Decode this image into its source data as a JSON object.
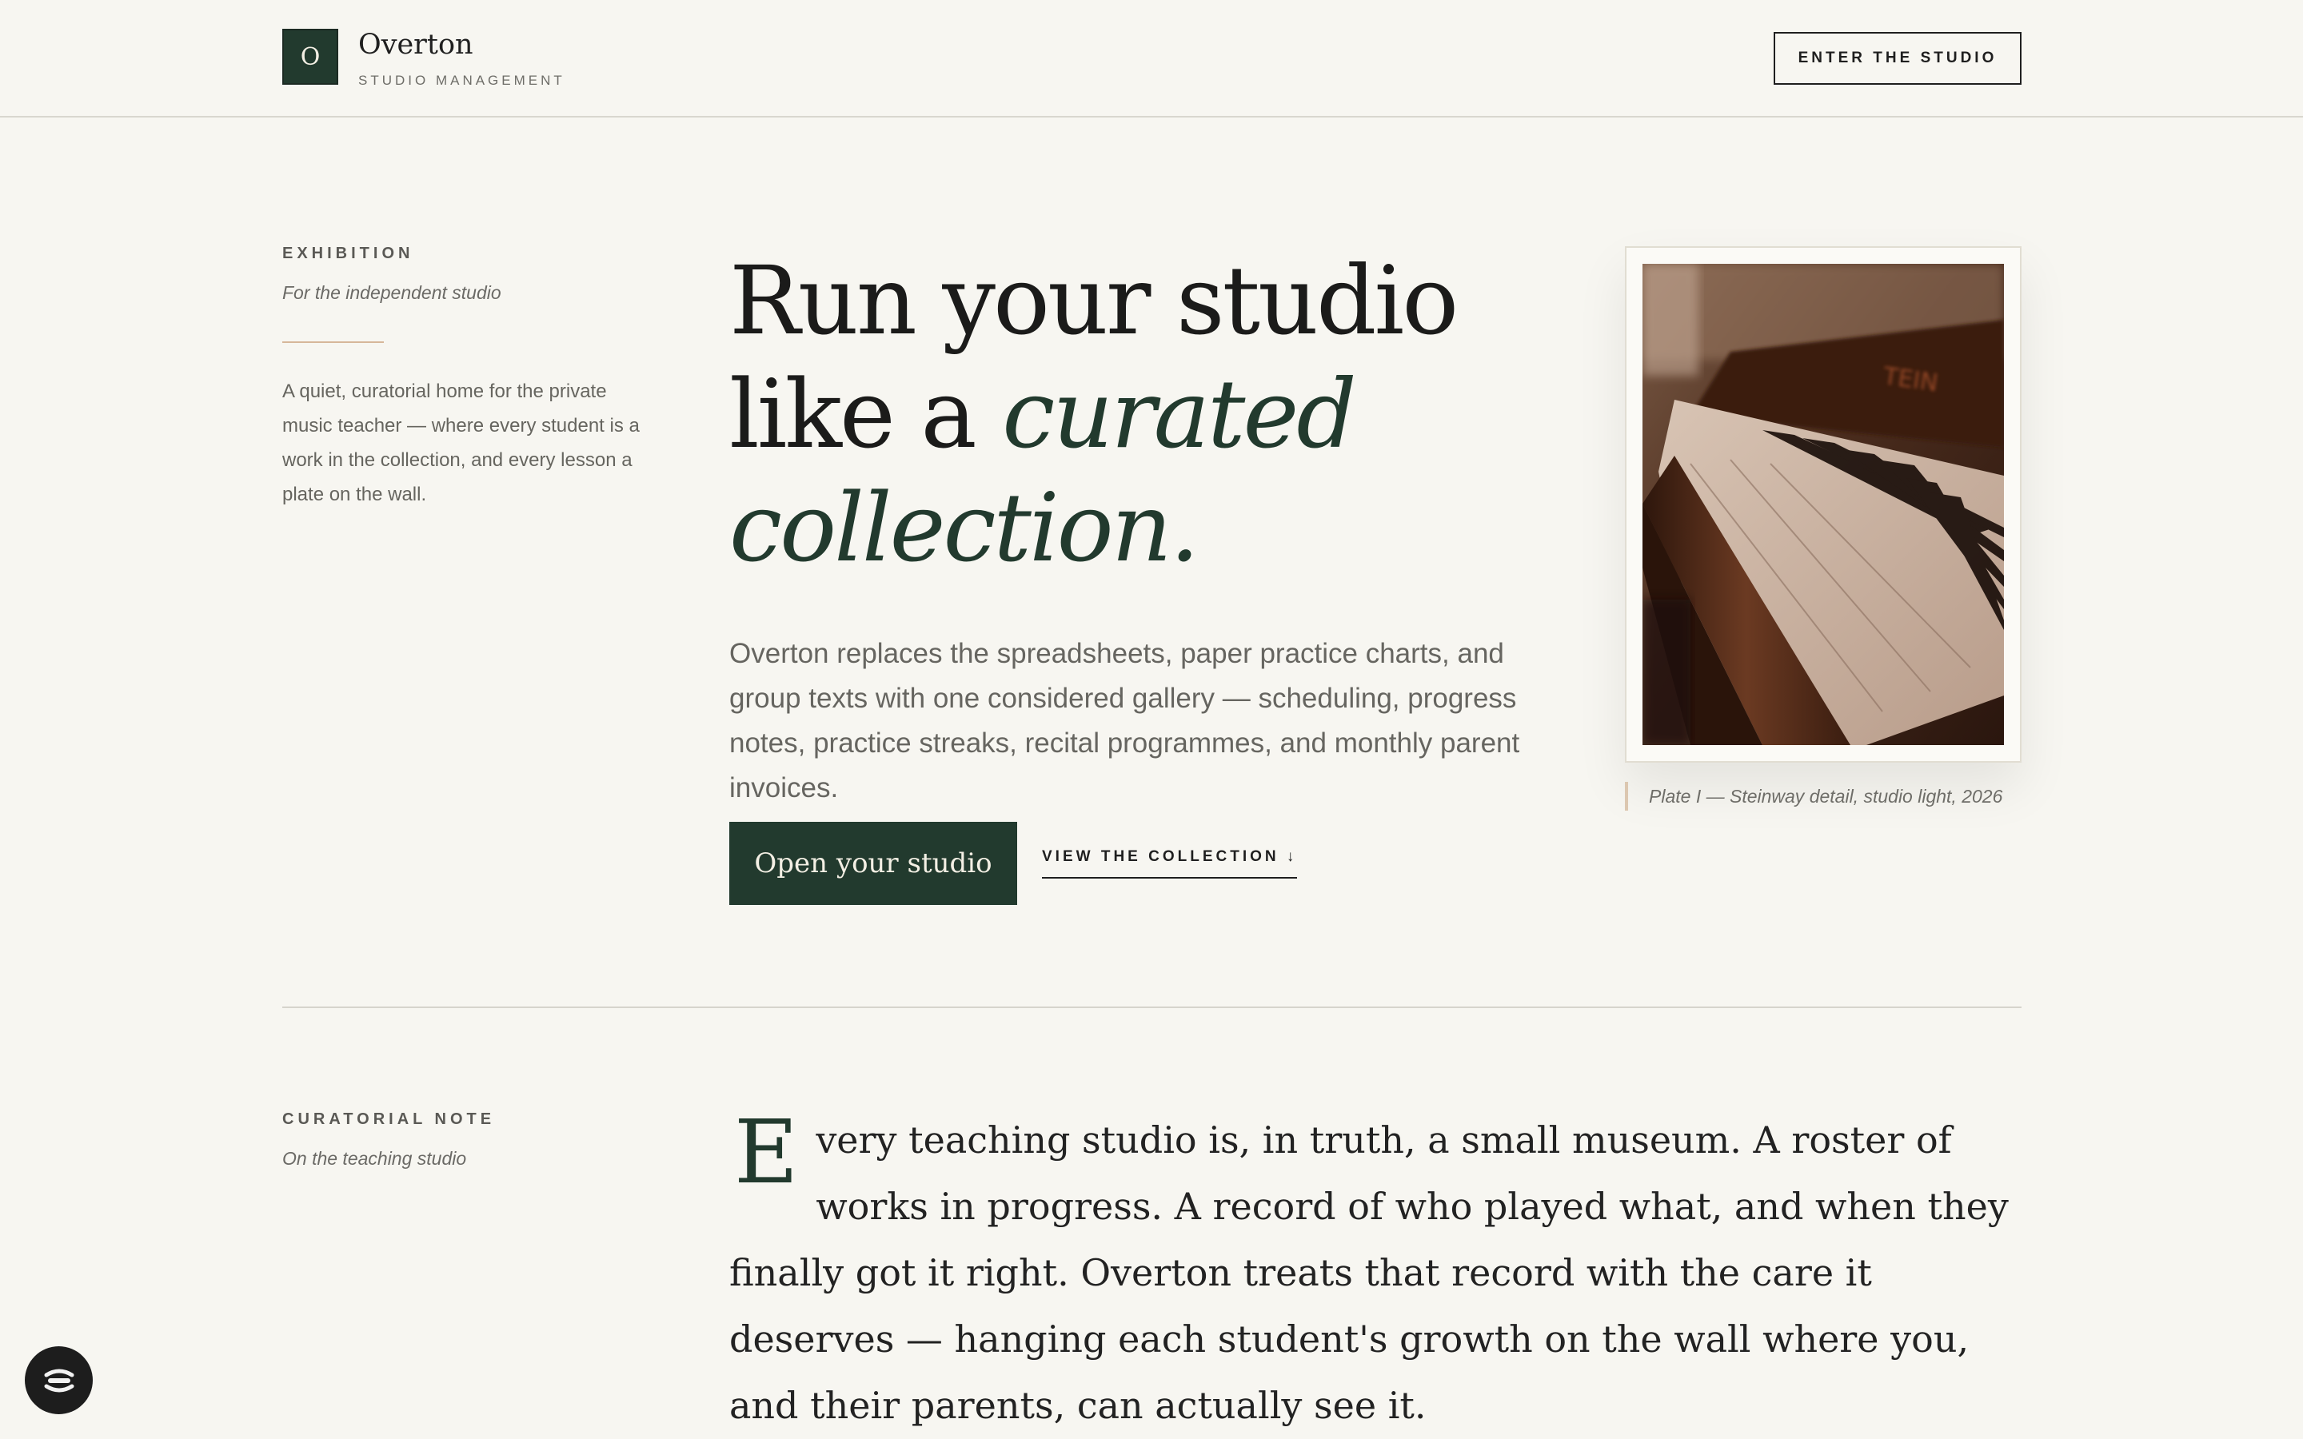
{
  "header": {
    "logo_letter": "O",
    "brand_name": "Overton",
    "brand_sub": "STUDIO MANAGEMENT",
    "cta_label": "ENTER THE STUDIO"
  },
  "hero": {
    "eyebrow": "EXHIBITION",
    "eyebrow_sub": "For the independent studio",
    "intro": "A quiet, curatorial home for the private music teacher — where every student is a work in the collection, and every lesson a plate on the wall.",
    "headline_line1": "Run your studio",
    "headline_line2_plain": "like a ",
    "headline_line2_accent": "curated",
    "headline_line3_accent": "collection.",
    "lede": "Overton replaces the spreadsheets, paper practice charts, and group texts with one considered gallery — scheduling, progress notes, practice streaks, recital programmes, and monthly parent invoices.",
    "primary_button": "Open your studio",
    "secondary_link": "VIEW THE COLLECTION ↓",
    "plate_caption": "Plate I — Steinway detail, studio light, 2026",
    "plate_image_text": "TEIN"
  },
  "note": {
    "eyebrow": "CURATORIAL NOTE",
    "eyebrow_sub": "On the teaching studio",
    "dropcap": "E",
    "body": "very teaching studio is, in truth, a small museum. A roster of works in progress. A record of who played what, and when they finally got it right. Overton treats that record with the care it deserves — hanging each student's growth on the wall where you, and their parents, can actually see it."
  },
  "colors": {
    "background": "#f7f6f1",
    "brand_green": "#223a2e",
    "accent_tan": "#d6b79a"
  },
  "icons": {
    "fab": "chat-widget-icon",
    "link_arrow": "arrow-down-icon"
  }
}
